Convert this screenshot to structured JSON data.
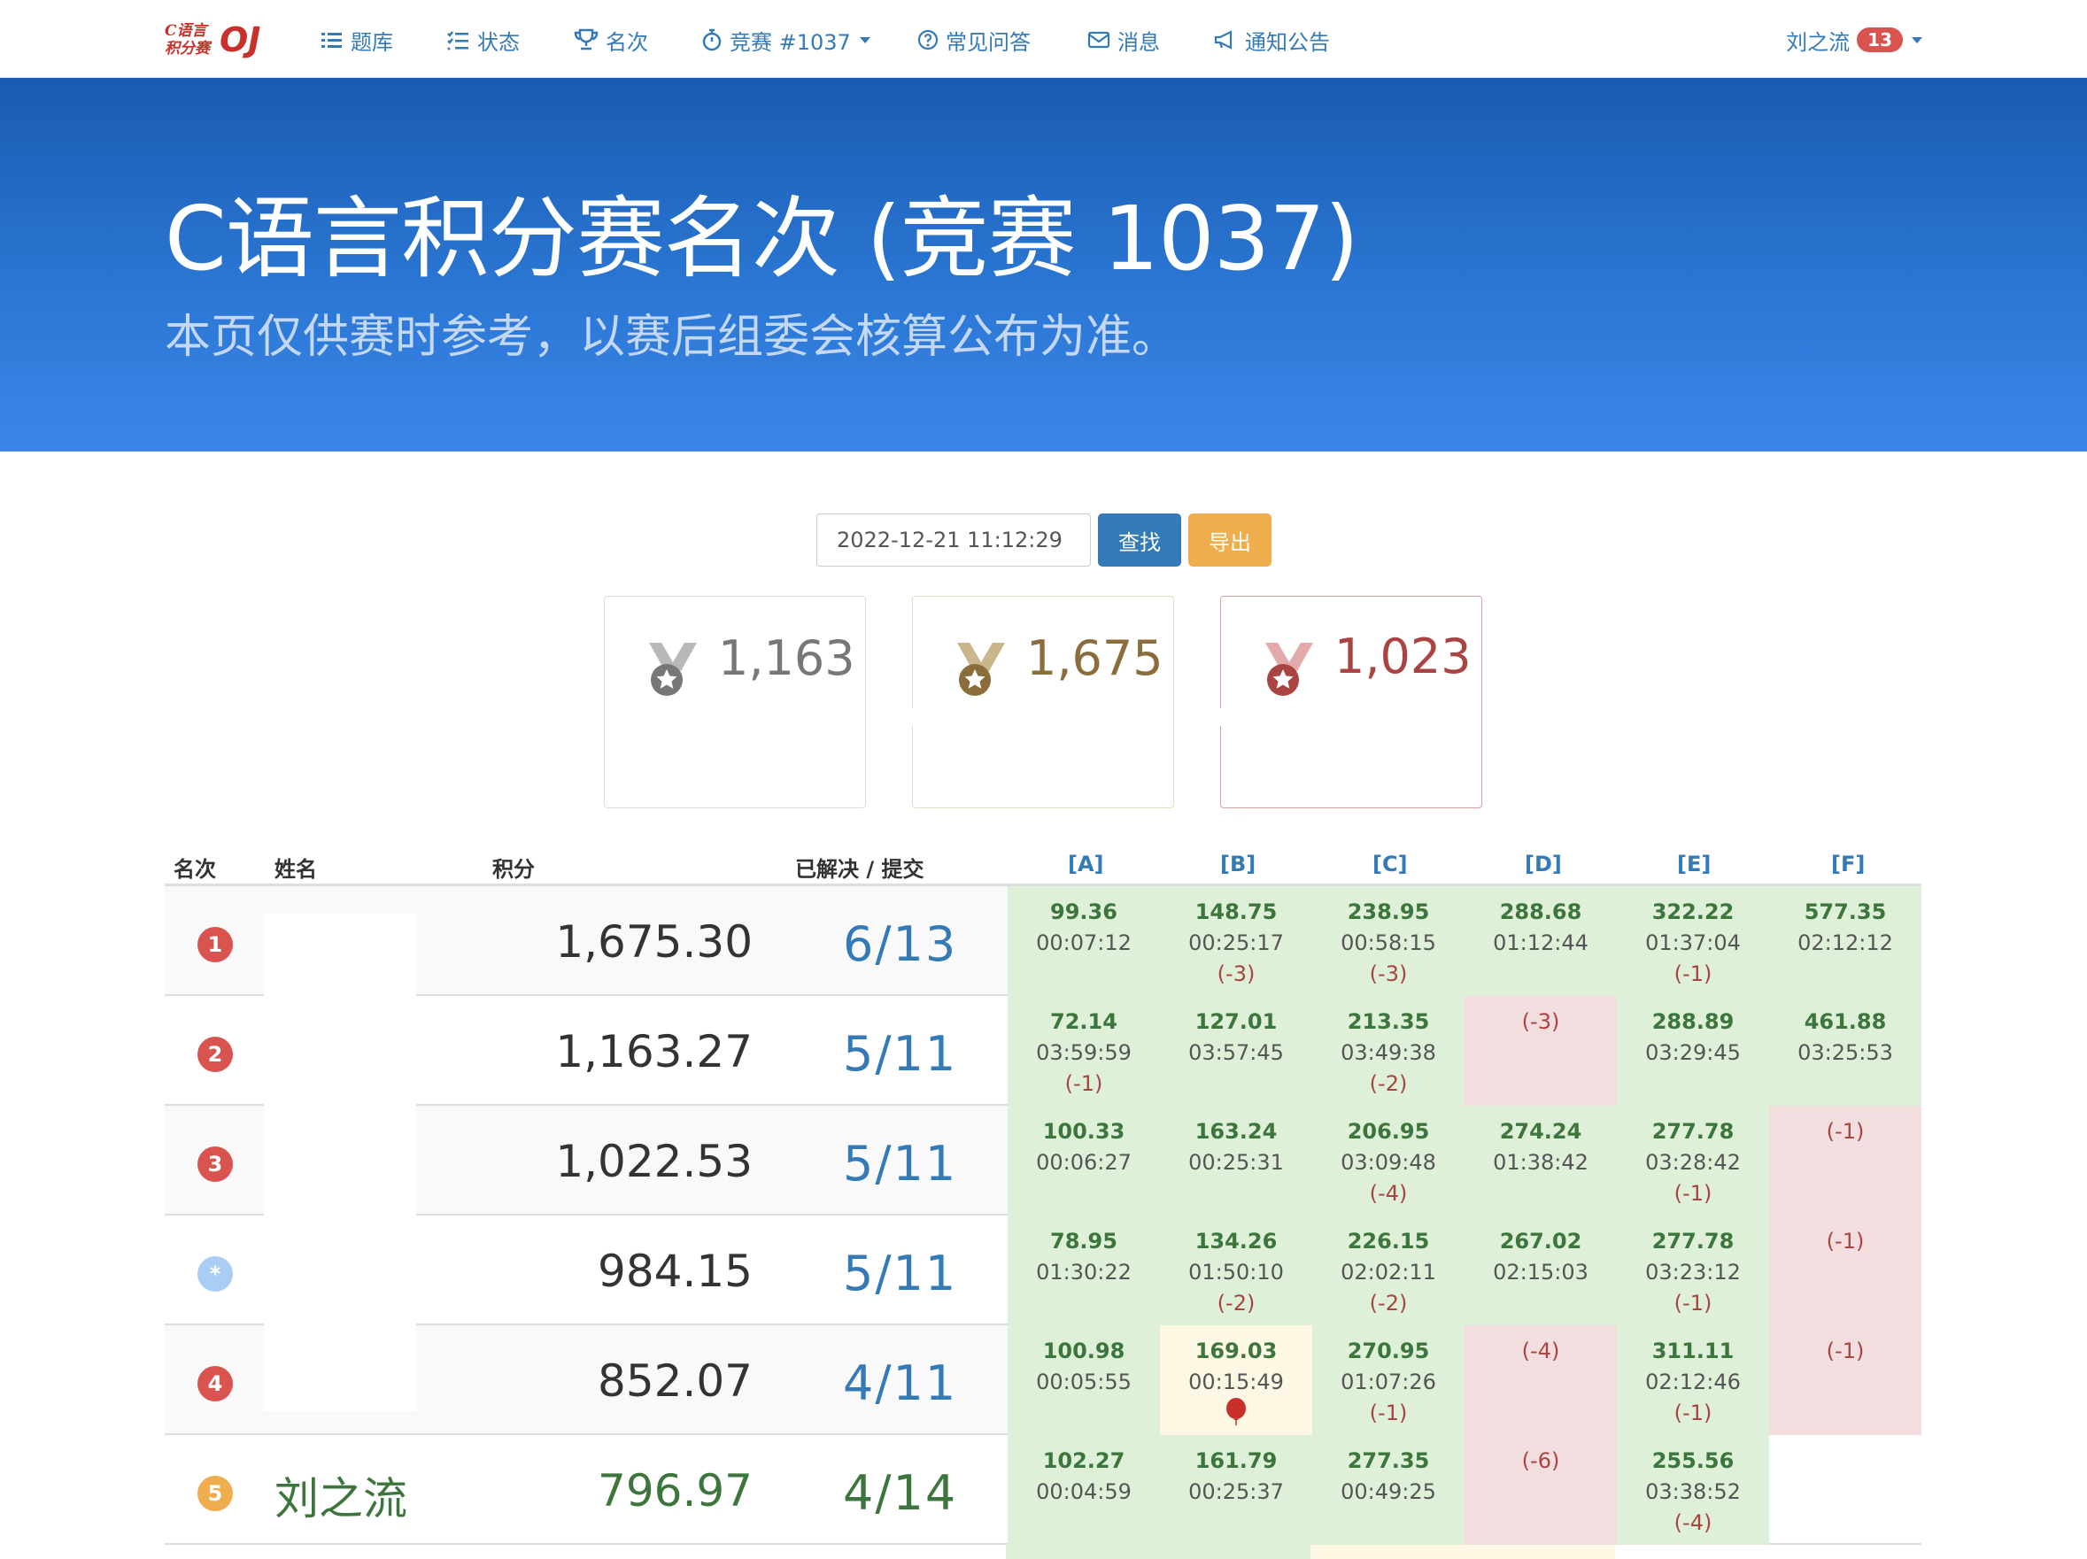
{
  "nav": {
    "logo_small_line1": "C语言",
    "logo_small_line2": "积分赛",
    "logo_big": "OJ",
    "items": [
      {
        "label": "题库",
        "icon": "list-icon"
      },
      {
        "label": "状态",
        "icon": "checklist-icon"
      },
      {
        "label": "名次",
        "icon": "trophy-icon"
      },
      {
        "label": "竞赛 #1037",
        "icon": "stopwatch-icon"
      },
      {
        "label": "常见问答",
        "icon": "question-circle-icon"
      },
      {
        "label": "消息",
        "icon": "envelope-icon"
      },
      {
        "label": "通知公告",
        "icon": "megaphone-icon"
      }
    ],
    "user": "刘之流",
    "user_badge": "13"
  },
  "hero": {
    "title": "C语言积分赛名次 (竞赛 1037)",
    "subtitle": "本页仅供赛时参考，以赛后组委会核算公布为准。"
  },
  "search": {
    "date_value": "2022-12-21 11:12:29",
    "search_label": "查找",
    "export_label": "导出"
  },
  "medals": [
    {
      "value": "1,163",
      "color": "#777777",
      "medal": "silver"
    },
    {
      "value": "1,675",
      "color": "#8a6d3b",
      "medal": "gold"
    },
    {
      "value": "1,023",
      "color": "#a94442",
      "medal": "bronze"
    }
  ],
  "table": {
    "headers": {
      "rank": "名次",
      "name": "姓名",
      "score": "积分",
      "solved": "已解决 / 提交"
    },
    "problems": [
      "[A]",
      "[B]",
      "[C]",
      "[D]",
      "[E]",
      "[F]"
    ],
    "rows": [
      {
        "rank": "1",
        "rank_color": "#d9534f",
        "name": "",
        "score": "1,675.30",
        "solved": "6",
        "submitted": "13",
        "cells": [
          {
            "state": "ok",
            "pt": "99.36",
            "tm": "00:07:12",
            "tr": ""
          },
          {
            "state": "ok",
            "pt": "148.75",
            "tm": "00:25:17",
            "tr": "(-3)"
          },
          {
            "state": "ok",
            "pt": "238.95",
            "tm": "00:58:15",
            "tr": "(-3)"
          },
          {
            "state": "ok",
            "pt": "288.68",
            "tm": "01:12:44",
            "tr": ""
          },
          {
            "state": "ok",
            "pt": "322.22",
            "tm": "01:37:04",
            "tr": "(-1)"
          },
          {
            "state": "ok",
            "pt": "577.35",
            "tm": "02:12:12",
            "tr": ""
          }
        ]
      },
      {
        "rank": "2",
        "rank_color": "#d9534f",
        "name": "",
        "score": "1,163.27",
        "solved": "5",
        "submitted": "11",
        "cells": [
          {
            "state": "ok",
            "pt": "72.14",
            "tm": "03:59:59",
            "tr": "(-1)"
          },
          {
            "state": "ok",
            "pt": "127.01",
            "tm": "03:57:45",
            "tr": ""
          },
          {
            "state": "ok",
            "pt": "213.35",
            "tm": "03:49:38",
            "tr": "(-2)"
          },
          {
            "state": "bad",
            "pt": "",
            "tm": "",
            "tr": "(-3)"
          },
          {
            "state": "ok",
            "pt": "288.89",
            "tm": "03:29:45",
            "tr": ""
          },
          {
            "state": "ok",
            "pt": "461.88",
            "tm": "03:25:53",
            "tr": ""
          }
        ]
      },
      {
        "rank": "3",
        "rank_color": "#d9534f",
        "name": "",
        "score": "1,022.53",
        "solved": "5",
        "submitted": "11",
        "cells": [
          {
            "state": "ok",
            "pt": "100.33",
            "tm": "00:06:27",
            "tr": ""
          },
          {
            "state": "ok",
            "pt": "163.24",
            "tm": "00:25:31",
            "tr": ""
          },
          {
            "state": "ok",
            "pt": "206.95",
            "tm": "03:09:48",
            "tr": "(-4)"
          },
          {
            "state": "ok",
            "pt": "274.24",
            "tm": "01:38:42",
            "tr": ""
          },
          {
            "state": "ok",
            "pt": "277.78",
            "tm": "03:28:42",
            "tr": "(-1)"
          },
          {
            "state": "bad",
            "pt": "",
            "tm": "",
            "tr": "(-1)"
          }
        ]
      },
      {
        "rank": "*",
        "rank_color": "#a9cdf5",
        "name": "",
        "score": "984.15",
        "solved": "5",
        "submitted": "11",
        "cells": [
          {
            "state": "ok",
            "pt": "78.95",
            "tm": "01:30:22",
            "tr": ""
          },
          {
            "state": "ok",
            "pt": "134.26",
            "tm": "01:50:10",
            "tr": "(-2)"
          },
          {
            "state": "ok",
            "pt": "226.15",
            "tm": "02:02:11",
            "tr": "(-2)"
          },
          {
            "state": "ok",
            "pt": "267.02",
            "tm": "02:15:03",
            "tr": ""
          },
          {
            "state": "ok",
            "pt": "277.78",
            "tm": "03:23:12",
            "tr": "(-1)"
          },
          {
            "state": "bad",
            "pt": "",
            "tm": "",
            "tr": "(-1)"
          }
        ]
      },
      {
        "rank": "4",
        "rank_color": "#d9534f",
        "name": "",
        "score": "852.07",
        "solved": "4",
        "submitted": "11",
        "cells": [
          {
            "state": "ok",
            "pt": "100.98",
            "tm": "00:05:55",
            "tr": ""
          },
          {
            "state": "first",
            "pt": "169.03",
            "tm": "00:15:49",
            "tr": "",
            "balloon": true
          },
          {
            "state": "ok",
            "pt": "270.95",
            "tm": "01:07:26",
            "tr": "(-1)"
          },
          {
            "state": "bad",
            "pt": "",
            "tm": "",
            "tr": "(-4)"
          },
          {
            "state": "ok",
            "pt": "311.11",
            "tm": "02:12:46",
            "tr": "(-1)"
          },
          {
            "state": "bad",
            "pt": "",
            "tm": "",
            "tr": "(-1)"
          }
        ]
      },
      {
        "rank": "5",
        "rank_color": "#f0ad4e",
        "name": "刘之流",
        "score": "796.97",
        "solved": "4",
        "submitted": "14",
        "highlight": true,
        "cells": [
          {
            "state": "ok",
            "pt": "102.27",
            "tm": "00:04:59",
            "tr": ""
          },
          {
            "state": "ok",
            "pt": "161.79",
            "tm": "00:25:37",
            "tr": ""
          },
          {
            "state": "ok",
            "pt": "277.35",
            "tm": "00:49:25",
            "tr": ""
          },
          {
            "state": "bad",
            "pt": "",
            "tm": "",
            "tr": "(-6)"
          },
          {
            "state": "ok",
            "pt": "255.56",
            "tm": "03:38:52",
            "tr": "(-4)"
          },
          {
            "state": "none",
            "pt": "",
            "tm": "",
            "tr": ""
          }
        ]
      }
    ]
  }
}
